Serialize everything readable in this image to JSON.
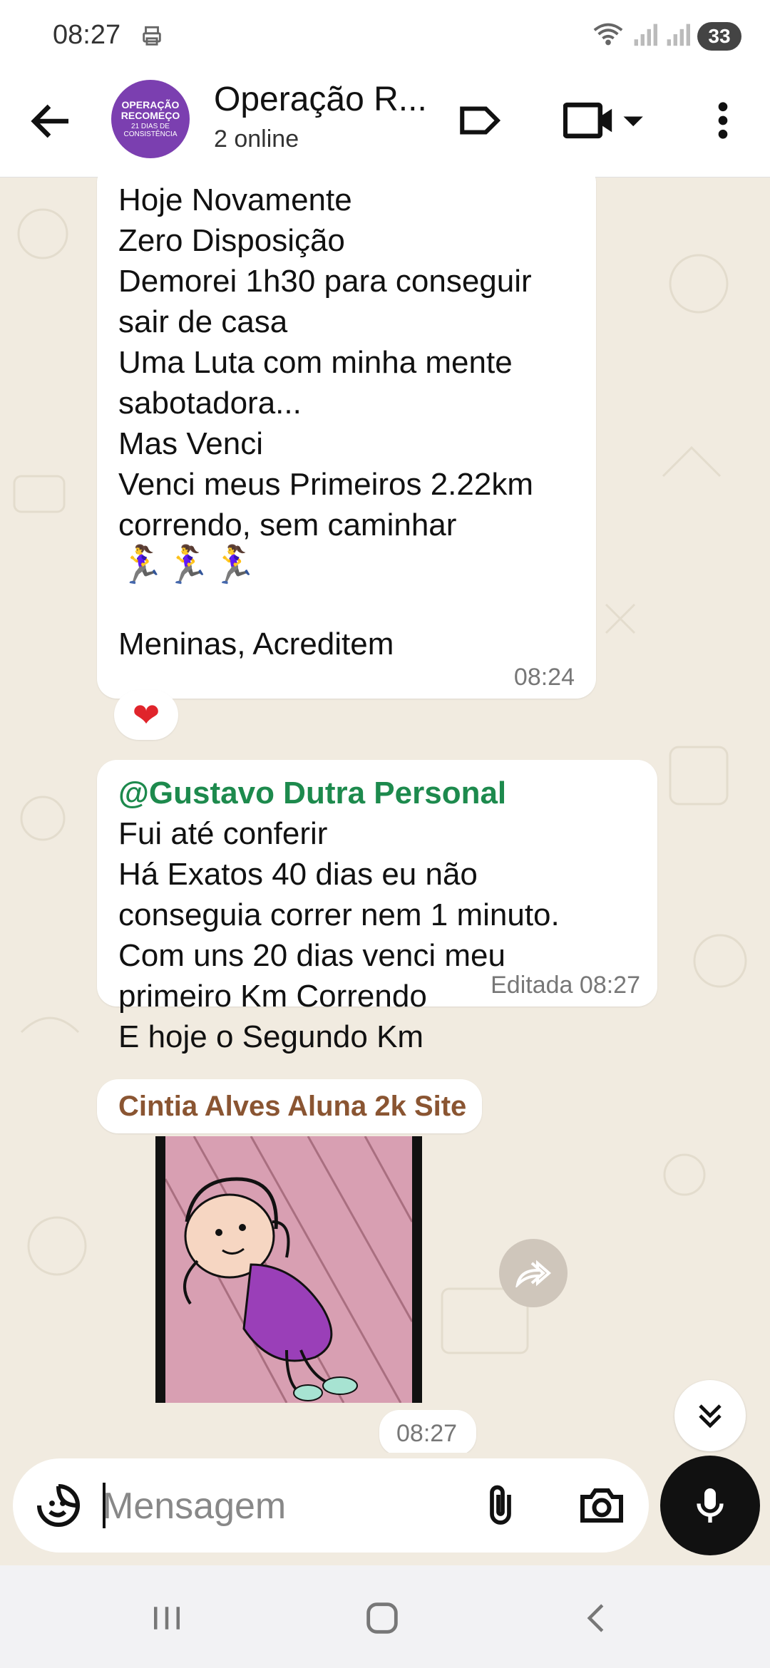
{
  "status_bar": {
    "time": "08:27",
    "battery": "33"
  },
  "header": {
    "avatar_line1": "OPERAÇÃO",
    "avatar_line2": "RECOMEÇO",
    "avatar_line3": "21 DIAS DE CONSISTÊNCIA",
    "title": "Operação R...",
    "subtitle": "2 online"
  },
  "messages": [
    {
      "lines": [
        "Hoje Novamente",
        "Zero Disposição",
        "Demorei 1h30 para conseguir",
        "sair de casa",
        "Uma Luta com minha mente",
        "sabotadora...",
        "Mas Venci",
        "Venci meus Primeiros 2.22km",
        "correndo, sem caminhar"
      ],
      "emoji": "🏃‍♀️🏃‍♀️🏃‍♀️",
      "last_line": "Meninas, Acreditem",
      "time": "08:24",
      "reaction": "❤"
    },
    {
      "mention": "@Gustavo Dutra Personal",
      "lines": [
        "Fui até conferir",
        "Há Exatos 40 dias eu não",
        "conseguia correr nem 1 minuto.",
        "Com uns 20 dias venci meu",
        "primeiro Km Correndo",
        "E hoje o Segundo Km"
      ],
      "edited": "Editada",
      "time": "08:27"
    },
    {
      "sender": "Cintia Alves Aluna 2k Site",
      "time": "08:27"
    }
  ],
  "input": {
    "placeholder": "Mensagem"
  },
  "colors": {
    "accent_green": "#1d8a4d",
    "sender_brown": "#8a5532",
    "avatar_purple": "#7b3fb0",
    "wallpaper": "#f1ebe0"
  }
}
